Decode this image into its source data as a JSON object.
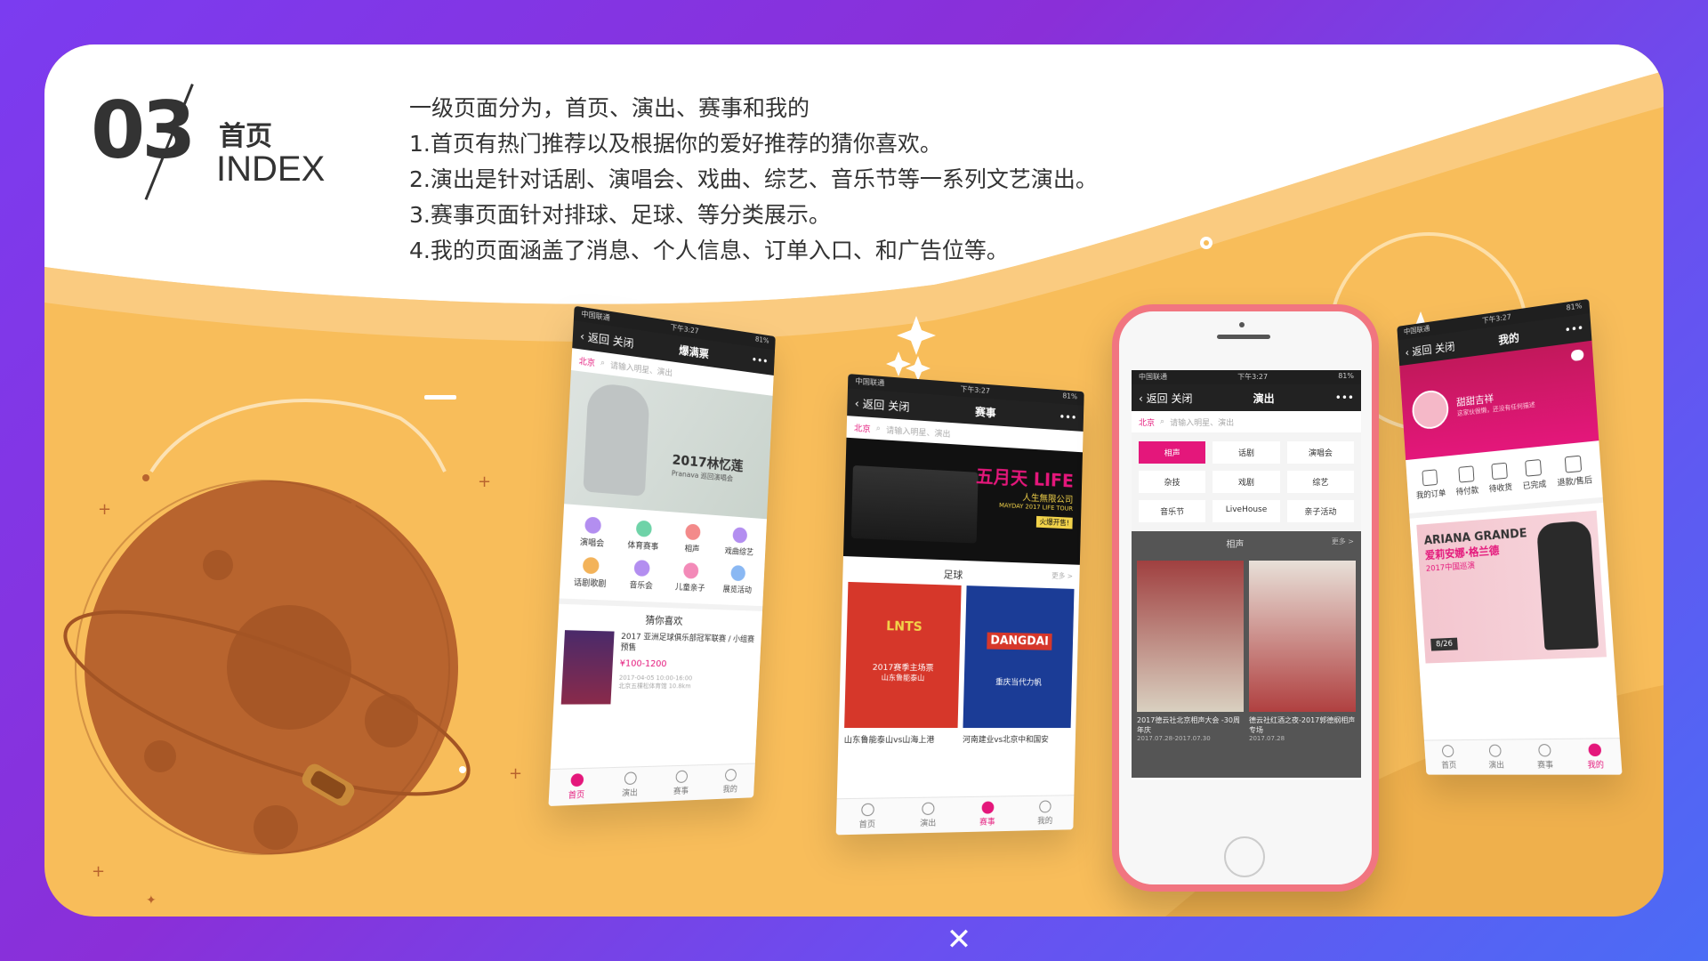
{
  "header": {
    "number": "03",
    "title_cn": "首页",
    "title_en": "INDEX"
  },
  "description": [
    "一级页面分为，首页、演出、赛事和我的",
    "1.首页有热门推荐以及根据你的爱好推荐的猜你喜欢。",
    "2.演出是针对话剧、演唱会、戏曲、综艺、音乐节等一系列文艺演出。",
    "3.赛事页面针对排球、足球、等分类展示。",
    "4.我的页面涵盖了消息、个人信息、订单入口、和广告位等。"
  ],
  "colors": {
    "accent": "#e4177b",
    "card": "#f8bd5a",
    "planet": "#b8642e"
  },
  "phone1": {
    "status_carrier": "中国联通",
    "status_time": "下午3:27",
    "status_battery": "81%",
    "back": "返回",
    "close": "关闭",
    "title": "爆满票",
    "city": "北京",
    "search_placeholder": "请输入明星、演出",
    "banner_title": "2017林忆莲",
    "banner_sub": "Pranava 巡回演唱会",
    "categories": [
      "演唱会",
      "体育赛事",
      "相声",
      "戏曲综艺",
      "话剧歌剧",
      "音乐会",
      "儿童亲子",
      "展览活动"
    ],
    "guess_title": "猜你喜欢",
    "guess_item_title": "2017 亚洲足球俱乐部冠军联赛 / 小组赛预售",
    "guess_item_price": "¥100-1200",
    "guess_item_date": "2017-04-05 10:00-16:00",
    "guess_item_place": "北京五棵松体育馆 10.8km",
    "tabs": [
      "首页",
      "演出",
      "赛事",
      "我的"
    ]
  },
  "phone2": {
    "status_carrier": "中国联通",
    "status_time": "下午3:27",
    "status_battery": "81%",
    "back": "返回",
    "close": "关闭",
    "title": "赛事",
    "city": "北京",
    "search_placeholder": "请输入明星、演出",
    "banner_title": "五月天 LIFE",
    "banner_sub": "人生無限公司",
    "banner_tour": "MAYDAY 2017 LIFE TOUR",
    "banner_tag": "火爆开售!",
    "section_title": "足球",
    "section_more": "更多 >",
    "card1_logo": "LNTS",
    "card1_label": "2017赛季主场票",
    "card1_team": "山东鲁能泰山",
    "card1_caption": "山东鲁能泰山vs山海上港",
    "card2_logo": "DANGDAI",
    "card2_team": "重庆当代力帆",
    "card2_caption": "河南建业vs北京中和国安",
    "tabs": [
      "首页",
      "演出",
      "赛事",
      "我的"
    ]
  },
  "phone3": {
    "status_carrier": "中国联通",
    "status_time": "下午3:27",
    "status_battery": "81%",
    "back": "返回",
    "close": "关闭",
    "title": "演出",
    "city": "北京",
    "search_placeholder": "请输入明星、演出",
    "grid": [
      "相声",
      "话剧",
      "演唱会",
      "杂技",
      "戏剧",
      "综艺",
      "音乐节",
      "LiveHouse",
      "亲子活动"
    ],
    "section_title": "相声",
    "section_more": "更多 >",
    "item1_title": "2017德云社北京相声大会 -30周年庆",
    "item1_date": "2017.07.28-2017.07.30",
    "item2_title": "德云社红酒之夜-2017郭德纲相声专场",
    "item2_date": "2017.07.28"
  },
  "phone4": {
    "status_carrier": "中国联通",
    "status_time": "下午3:27",
    "status_battery": "81%",
    "back": "返回",
    "close": "关闭",
    "title": "我的",
    "username": "甜甜吉祥",
    "user_sub": "这家伙很懒，还没有任何描述",
    "order_items": [
      "我的订单",
      "待付款",
      "待收货",
      "已完成",
      "退款/售后"
    ],
    "ad_title": "ARIANA GRANDE",
    "ad_sub": "爱莉安娜·格兰德",
    "ad_tour": "2017中国巡演",
    "ad_date": "8/26",
    "tabs": [
      "首页",
      "演出",
      "赛事",
      "我的"
    ]
  }
}
